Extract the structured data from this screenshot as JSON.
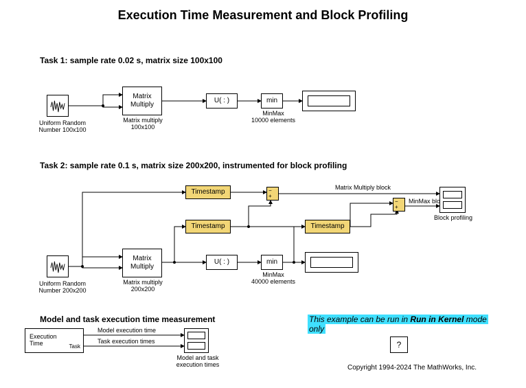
{
  "title": "Execution Time Measurement and Block Profiling",
  "task1": {
    "heading": "Task 1: sample rate 0.02 s, matrix size 100x100",
    "random_label": "Uniform Random\nNumber 100x100",
    "matmul_text": "Matrix\nMultiply",
    "matmul_label": "Matrix multiply\n100x100",
    "reshape_text": "U( : )",
    "min_text": "min",
    "minmax_label": "MinMax\n10000 elements"
  },
  "task2": {
    "heading": "Task 2: sample rate 0.1 s, matrix size 200x200, instrumented for block profiling",
    "random_label": "Uniform Random\nNumber 200x200",
    "matmul_text": "Matrix\nMultiply",
    "matmul_label": "Matrix multiply\n200x200",
    "reshape_text": "U( : )",
    "min_text": "min",
    "minmax_label": "MinMax\n40000 elements",
    "timestamp": "Timestamp",
    "sig_mm": "Matrix Multiply block",
    "sig_minmax": "MinMax block",
    "scope_label": "Block profiling"
  },
  "exec": {
    "heading": "Model and task execution time measurement",
    "block_text": "Execution\nTime",
    "block_port_task": "Task",
    "sig_model": "Model execution time",
    "sig_task": "Task execution times",
    "scope_label": "Model and task\nexecution times"
  },
  "note": {
    "line1_plain": "This example can be run in ",
    "line1_bold": "Run in Kernel",
    "line1_tail": " mode",
    "line2": "only"
  },
  "help": "?",
  "copyright": "Copyright 1994-2024 The MathWorks, Inc."
}
